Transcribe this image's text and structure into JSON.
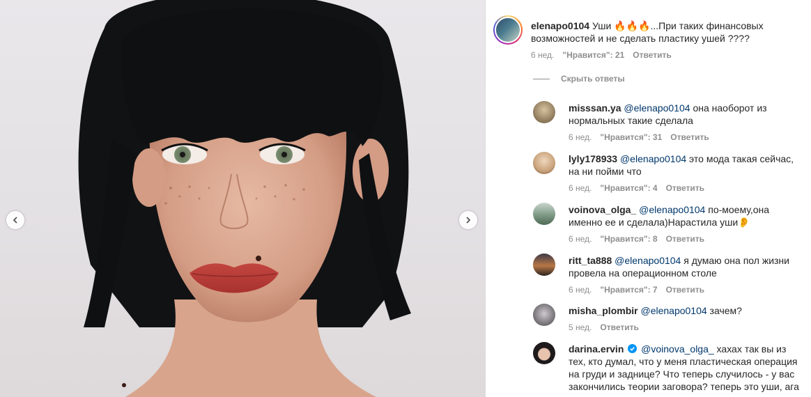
{
  "post": {
    "nav_prev_icon": "chevron-left-icon",
    "nav_next_icon": "chevron-right-icon"
  },
  "main_comment": {
    "username": "elenapo0104",
    "text_before": "Уши ",
    "text_after": "...При таких финансовых возможностей и не сделать пластику ушей ????",
    "emoji": "🔥🔥🔥",
    "time": "6 нед.",
    "likes": "\"Нравится\": 21",
    "reply": "Ответить"
  },
  "hide_replies": "Скрыть ответы",
  "replies": [
    {
      "username": "misssan.ya",
      "mention": "@elenapo0104",
      "text": " она наоборот из нормальных такие сделала",
      "time": "6 нед.",
      "likes": "\"Нравится\": 31",
      "reply": "Ответить",
      "avatar_color": "#8a7658"
    },
    {
      "username": "lyly178933",
      "mention": "@elenapo0104",
      "text": " это мода такая сейчас, на ни пойми что",
      "time": "6 нед.",
      "likes": "\"Нравится\": 4",
      "reply": "Ответить",
      "avatar_color": "#c9a27a"
    },
    {
      "username": "voinova_olga_",
      "mention": "@elenapo0104",
      "text": " по-моему,она именно ее и сделала)Нарастила уши",
      "emoji": "👂",
      "time": "6 нед.",
      "likes": "\"Нравится\": 8",
      "reply": "Ответить",
      "avatar_color": "#7f9a86"
    },
    {
      "username": "ritt_ta888",
      "mention": "@elenapo0104",
      "text": " я думаю она пол жизни провела на операционном столе",
      "time": "6 нед.",
      "likes": "\"Нравится\": 7",
      "reply": "Ответить",
      "avatar_color": "#b87745"
    },
    {
      "username": "misha_plombir",
      "mention": "@elenapo0104",
      "text": " зачем?",
      "time": "5 нед.",
      "reply": "Ответить",
      "avatar_color": "#6e6c70"
    },
    {
      "username": "darina.ervin",
      "mention": "@voinova_olga_",
      "text": " хахах так вы из тех, кто думал, что у меня пластическая операция на груди и заднице? Что теперь случилось - у вас закончились теории заговора? теперь это уши, ага",
      "verified": true,
      "avatar_color": "#1e1a1c"
    }
  ],
  "colors": {
    "mention": "#00376b",
    "meta_text": "#8e8e8e",
    "verified": "#0095f6"
  }
}
